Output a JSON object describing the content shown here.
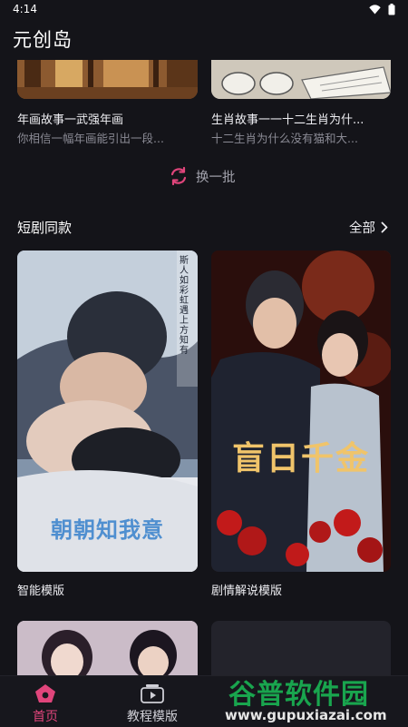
{
  "status_bar": {
    "time": "4:14"
  },
  "app": {
    "title": "元创岛"
  },
  "stories": [
    {
      "title": "年画故事一武强年画",
      "desc": "你相信一幅年画能引出一段..."
    },
    {
      "title": "生肖故事一一十二生肖为什...",
      "desc": "十二生肖为什么没有猫和大..."
    }
  ],
  "refresh": {
    "label": "换一批"
  },
  "section": {
    "title": "短剧同款",
    "see_all": "全部"
  },
  "posters": [
    {
      "caption": "智能模版",
      "text_overlay": "朝朝知我意",
      "side_text": "斯人如彩虹 遇上方知有"
    },
    {
      "caption": "剧情解说模版",
      "text_overlay": "盲日千金"
    }
  ],
  "tabs": [
    {
      "label": "首页"
    },
    {
      "label": "教程模版"
    }
  ],
  "watermark": {
    "title": "谷普软件园",
    "url": "www.gupuxiazai.com"
  },
  "colors": {
    "accent": "#e0457b",
    "background": "#141419",
    "watermark_green": "#19a54e"
  }
}
